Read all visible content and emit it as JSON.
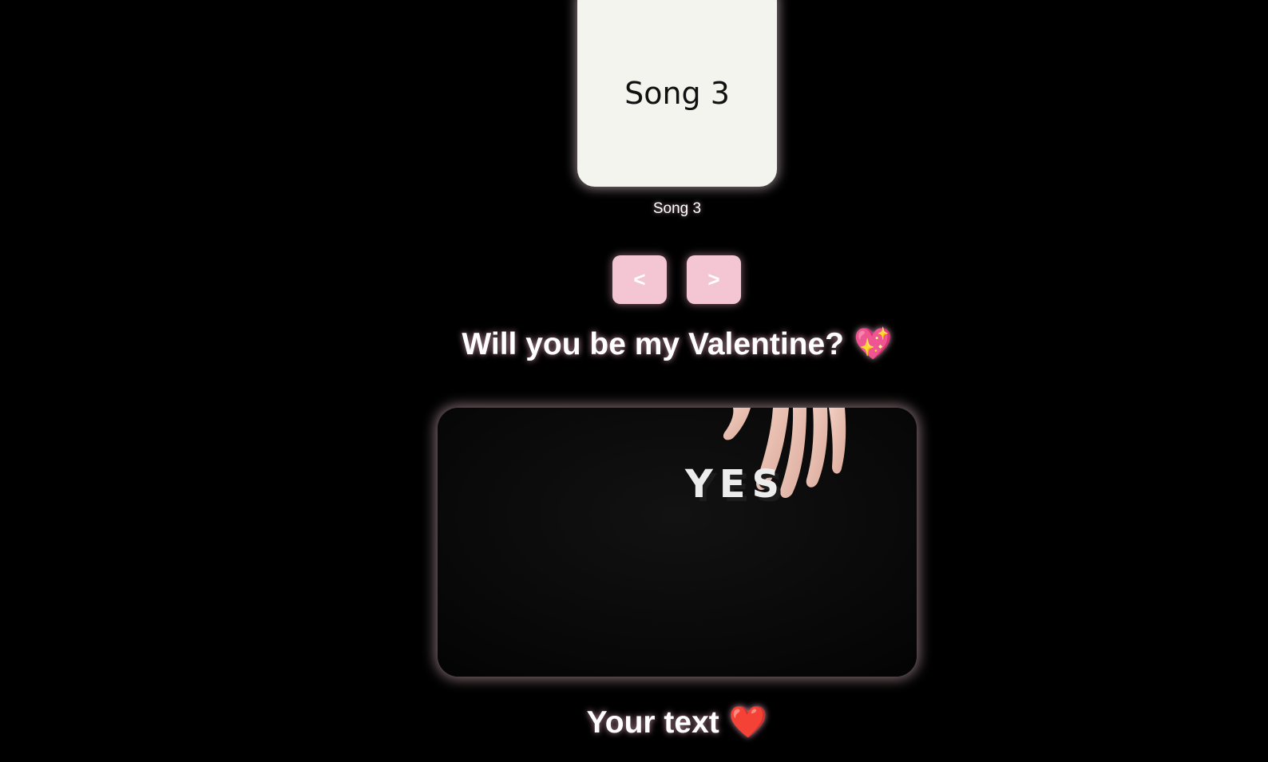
{
  "player": {
    "album_title": "Song 3",
    "song_caption": "Song 3",
    "prev_label": "<",
    "next_label": ">"
  },
  "question": {
    "text": "Will you be my Valentine?",
    "emoji": "💖",
    "emoji_name": "sparkling-heart-icon"
  },
  "video": {
    "word": "YES"
  },
  "footer": {
    "text": "Your text",
    "emoji": "❤️",
    "emoji_name": "red-heart-icon"
  },
  "colors": {
    "background": "#000000",
    "card": "#f3f4ee",
    "button": "#f4c5d2",
    "glow": "#ffd7e1"
  }
}
